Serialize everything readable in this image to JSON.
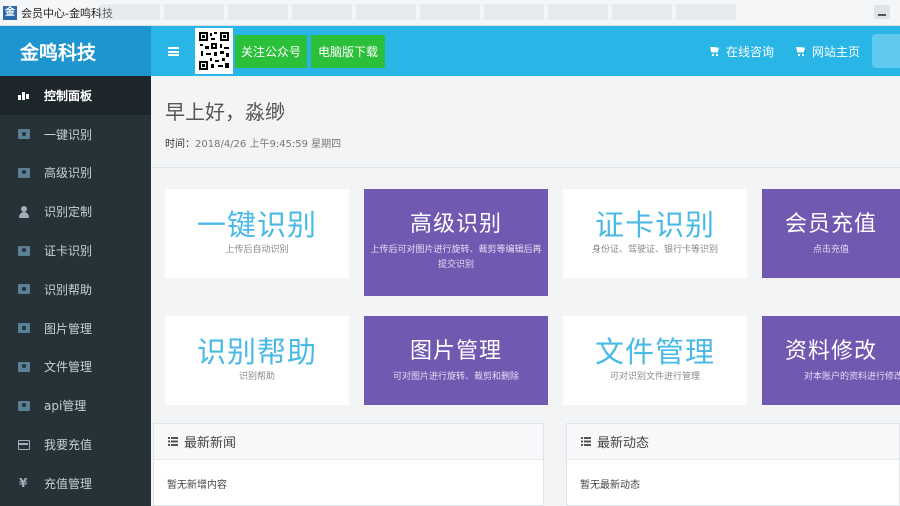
{
  "window": {
    "title": "会员中心-金鸣科技"
  },
  "brand": {
    "name": "金鸣科技"
  },
  "topbar": {
    "follow_label": "关注公众号",
    "download_label": "电脑版下载",
    "links": [
      {
        "label": "在线咨询",
        "icon": "cart-icon"
      },
      {
        "label": "网站主页",
        "icon": "cart-icon"
      }
    ]
  },
  "sidebar": {
    "items": [
      {
        "label": "控制面板",
        "icon": "bar-chart-icon",
        "active": true
      },
      {
        "label": "一键识别",
        "icon": "money-icon"
      },
      {
        "label": "高级识别",
        "icon": "money-icon"
      },
      {
        "label": "识别定制",
        "icon": "user-icon"
      },
      {
        "label": "证卡识别",
        "icon": "money-icon"
      },
      {
        "label": "识别帮助",
        "icon": "money-icon"
      },
      {
        "label": "图片管理",
        "icon": "money-icon"
      },
      {
        "label": "文件管理",
        "icon": "money-icon"
      },
      {
        "label": "api管理",
        "icon": "money-icon"
      },
      {
        "label": "我要充值",
        "icon": "credit-card-icon"
      },
      {
        "label": "充值管理",
        "icon": "yen-icon"
      }
    ]
  },
  "main": {
    "greeting": "早上好，淼缈",
    "time_label": "时间：",
    "time_value": "2018/4/26 上午9:45:59 星期四",
    "tiles": [
      {
        "title": "一键识别",
        "subtitle": "上传后自动识别",
        "style": "white"
      },
      {
        "title": "高级识别",
        "subtitle": "上传后可对图片进行旋转、裁剪等编辑后再提交识别",
        "style": "purple"
      },
      {
        "title": "证卡识别",
        "subtitle": "身份证、驾驶证、银行卡等识别",
        "style": "white"
      },
      {
        "title": "会员充值",
        "subtitle": "点击充值",
        "style": "purple"
      },
      {
        "title": "识别帮助",
        "subtitle": "识别帮助",
        "style": "white"
      },
      {
        "title": "图片管理",
        "subtitle": "可对图片进行旋转、裁剪和删除",
        "style": "purple"
      },
      {
        "title": "文件管理",
        "subtitle": "可对识别文件进行管理",
        "style": "white"
      },
      {
        "title": "资料修改",
        "subtitle": "对本账户的资料进行修改",
        "style": "purple"
      }
    ],
    "news": {
      "title": "最新新闻",
      "empty_text": "暂无新增内容"
    },
    "activity": {
      "title": "最新动态",
      "empty_text": "暂无最新动态"
    }
  },
  "colors": {
    "brand_blue": "#1f95cf",
    "topbar_blue": "#29b6e6",
    "green_button": "#2bbf3a",
    "tile_purple": "#7158b0",
    "tile_text_blue": "#49b9e5",
    "sidebar_bg": "#263238"
  }
}
